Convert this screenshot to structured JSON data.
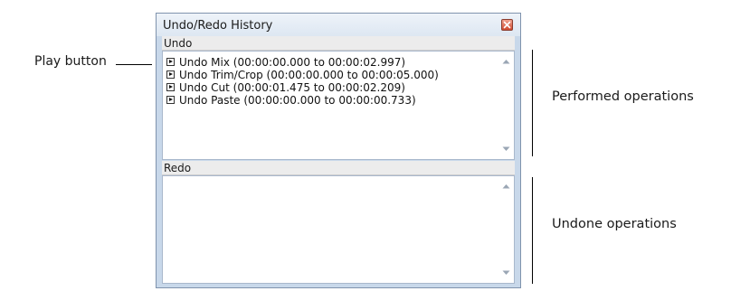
{
  "callouts": {
    "play_button": "Play button",
    "performed": "Performed operations",
    "undone": "Undone operations"
  },
  "window": {
    "title": "Undo/Redo History",
    "close_icon": "close-icon"
  },
  "undo": {
    "header": "Undo",
    "items": [
      {
        "label": "Undo Mix (00:00:00.000 to 00:00:02.997)"
      },
      {
        "label": "Undo Trim/Crop (00:00:00.000 to 00:00:05.000)"
      },
      {
        "label": "Undo Cut (00:00:01.475 to 00:00:02.209)"
      },
      {
        "label": "Undo Paste (00:00:00.000 to 00:00:00.733)"
      }
    ]
  },
  "redo": {
    "header": "Redo",
    "items": []
  },
  "colors": {
    "window_frame": "#c8d8ea",
    "close_button": "#cf4a30"
  }
}
